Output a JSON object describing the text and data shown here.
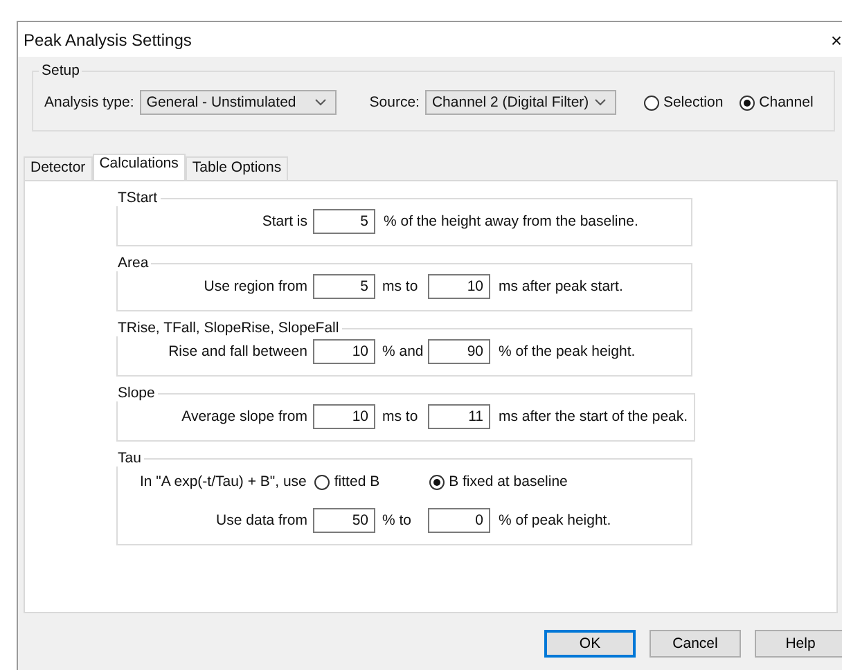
{
  "window": {
    "title": "Peak Analysis Settings",
    "close": "×"
  },
  "setup": {
    "title": "Setup",
    "analysis_type": {
      "label": "Analysis type:",
      "value": "General - Unstimulated"
    },
    "source": {
      "label": "Source:",
      "value": "Channel 2 (Digital Filter)"
    },
    "radios": [
      {
        "label": "Selection",
        "selected": false
      },
      {
        "label": "Channel",
        "selected": true
      }
    ]
  },
  "tabs": [
    {
      "label": "Detector",
      "selected": false
    },
    {
      "label": "Calculations",
      "selected": true
    },
    {
      "label": "Table Options",
      "selected": false
    }
  ],
  "groups": [
    {
      "title": "TStart",
      "rows": [
        [
          {
            "kind": "text",
            "text": "Start is"
          },
          {
            "kind": "field",
            "value": "5"
          },
          {
            "kind": "text",
            "text": "% of the height away from the baseline."
          }
        ]
      ]
    },
    {
      "title": "Area",
      "rows": [
        [
          {
            "kind": "text",
            "text": "Use region from"
          },
          {
            "kind": "field",
            "value": "5"
          },
          {
            "kind": "text",
            "text": "ms to"
          },
          {
            "kind": "field",
            "value": "10"
          },
          {
            "kind": "text",
            "text": "ms after peak start."
          }
        ]
      ]
    },
    {
      "title": "TRise, TFall, SlopeRise, SlopeFall",
      "rows": [
        [
          {
            "kind": "text",
            "text": "Rise and fall between"
          },
          {
            "kind": "field",
            "value": "10"
          },
          {
            "kind": "text",
            "text": "% and"
          },
          {
            "kind": "field",
            "value": "90"
          },
          {
            "kind": "text",
            "text": "% of the peak height."
          }
        ]
      ]
    },
    {
      "title": "Slope",
      "rows": [
        [
          {
            "kind": "text",
            "text": "Average slope from"
          },
          {
            "kind": "field",
            "value": "10"
          },
          {
            "kind": "text",
            "text": "ms to"
          },
          {
            "kind": "field",
            "value": "11"
          },
          {
            "kind": "text",
            "text": "ms after the start of the peak."
          }
        ]
      ]
    },
    {
      "title": "Tau",
      "choice": {
        "label": "In  \"A exp(-t/Tau) + B\", use",
        "options": [
          {
            "label": "fitted B",
            "selected": false
          },
          {
            "label": "B fixed at baseline",
            "selected": true
          }
        ]
      },
      "rows": [
        [
          {
            "kind": "text",
            "text": "Use data from"
          },
          {
            "kind": "field",
            "value": "50"
          },
          {
            "kind": "text",
            "text": "% to"
          },
          {
            "kind": "field",
            "value": "0"
          },
          {
            "kind": "text",
            "text": "% of peak height."
          }
        ]
      ]
    }
  ],
  "buttons": [
    {
      "label": "OK",
      "default": true
    },
    {
      "label": "Cancel",
      "default": false
    },
    {
      "label": "Help",
      "default": false
    }
  ]
}
